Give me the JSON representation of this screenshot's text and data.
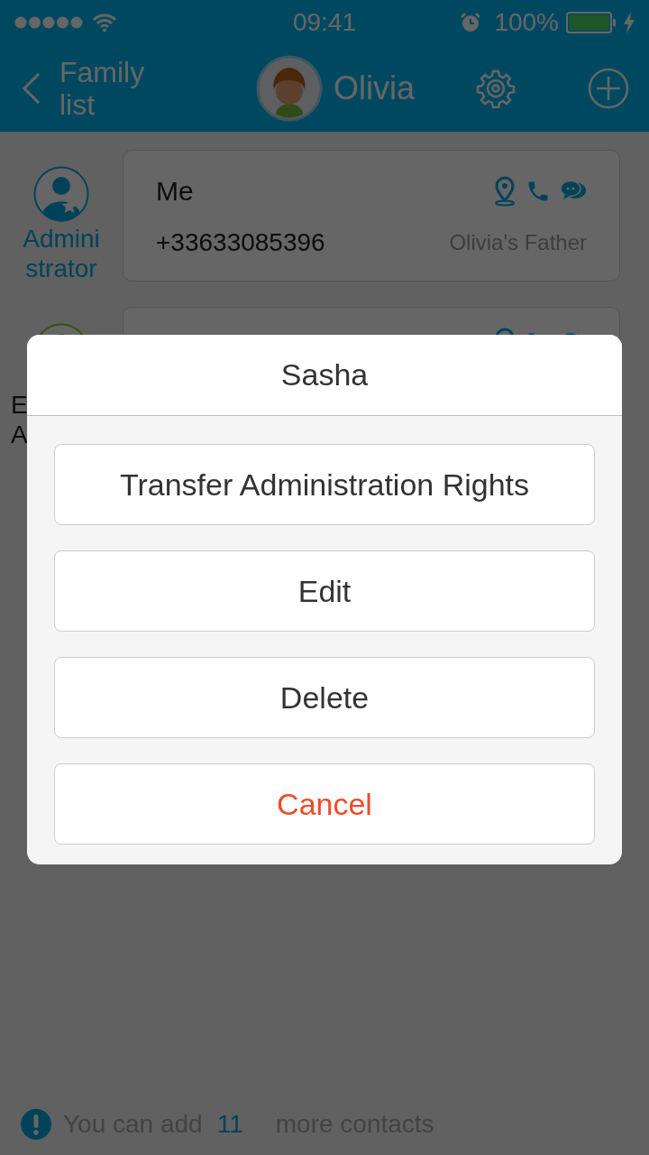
{
  "status_bar": {
    "time": "09:41",
    "battery": "100%"
  },
  "nav": {
    "back_label": "Family list",
    "title": "Olivia"
  },
  "contacts": [
    {
      "role_lines": [
        "Admini",
        "strator"
      ],
      "name": "Me",
      "phone": "+33633085396",
      "relation": "Olivia's Father",
      "kind": "admin"
    },
    {
      "role_lines": [
        "E",
        "A"
      ],
      "kind": "member"
    }
  ],
  "footer": {
    "before": "You can add",
    "count": "11",
    "after": "more contacts"
  },
  "sheet": {
    "title": "Sasha",
    "actions": [
      {
        "label": "Transfer Administration Rights",
        "kind": "default"
      },
      {
        "label": "Edit",
        "kind": "default"
      },
      {
        "label": "Delete",
        "kind": "default"
      },
      {
        "label": "Cancel",
        "kind": "cancel"
      }
    ]
  }
}
